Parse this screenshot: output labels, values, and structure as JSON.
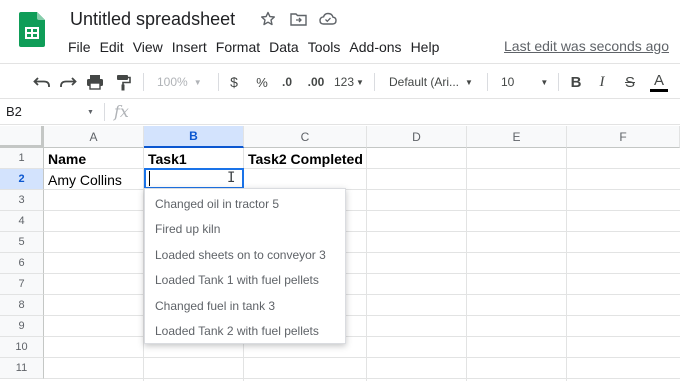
{
  "document": {
    "title": "Untitled spreadsheet",
    "last_edit": "Last edit was seconds ago"
  },
  "menu": {
    "items": [
      "File",
      "Edit",
      "View",
      "Insert",
      "Format",
      "Data",
      "Tools",
      "Add-ons",
      "Help"
    ]
  },
  "toolbar": {
    "zoom": "100%",
    "currency": "$",
    "percent": "%",
    "decrease_decimals": ".0",
    "increase_decimals": ".00",
    "more_formats": "123",
    "font": "Default (Ari...",
    "font_size": "10",
    "bold": "B",
    "italic": "I",
    "strikethrough": "S",
    "text_color": "A"
  },
  "formula_bar": {
    "name_box": "B2",
    "fx": "fx",
    "value": ""
  },
  "sheet": {
    "columns": [
      "A",
      "B",
      "C",
      "D",
      "E",
      "F"
    ],
    "rows": [
      "1",
      "2",
      "3",
      "4",
      "5",
      "6",
      "7",
      "8",
      "9",
      "10",
      "11"
    ],
    "selected_column": "B",
    "selected_row": "2",
    "cells": {
      "A1": "Name",
      "B1": "Task1",
      "C1": "Task2 Completed",
      "A2": "Amy Collins",
      "B2": ""
    }
  },
  "dropdown": {
    "options": [
      "Changed oil in tractor 5",
      "Fired up kiln",
      "Loaded sheets on to conveyor 3",
      "Loaded Tank 1 with fuel pellets",
      "Changed fuel in tank 3",
      "Loaded Tank 2 with fuel pellets"
    ]
  },
  "colors": {
    "accent": "#1a73e8",
    "sheets_green": "#0f9d58",
    "selected_header_bg": "#d3e3fd"
  }
}
